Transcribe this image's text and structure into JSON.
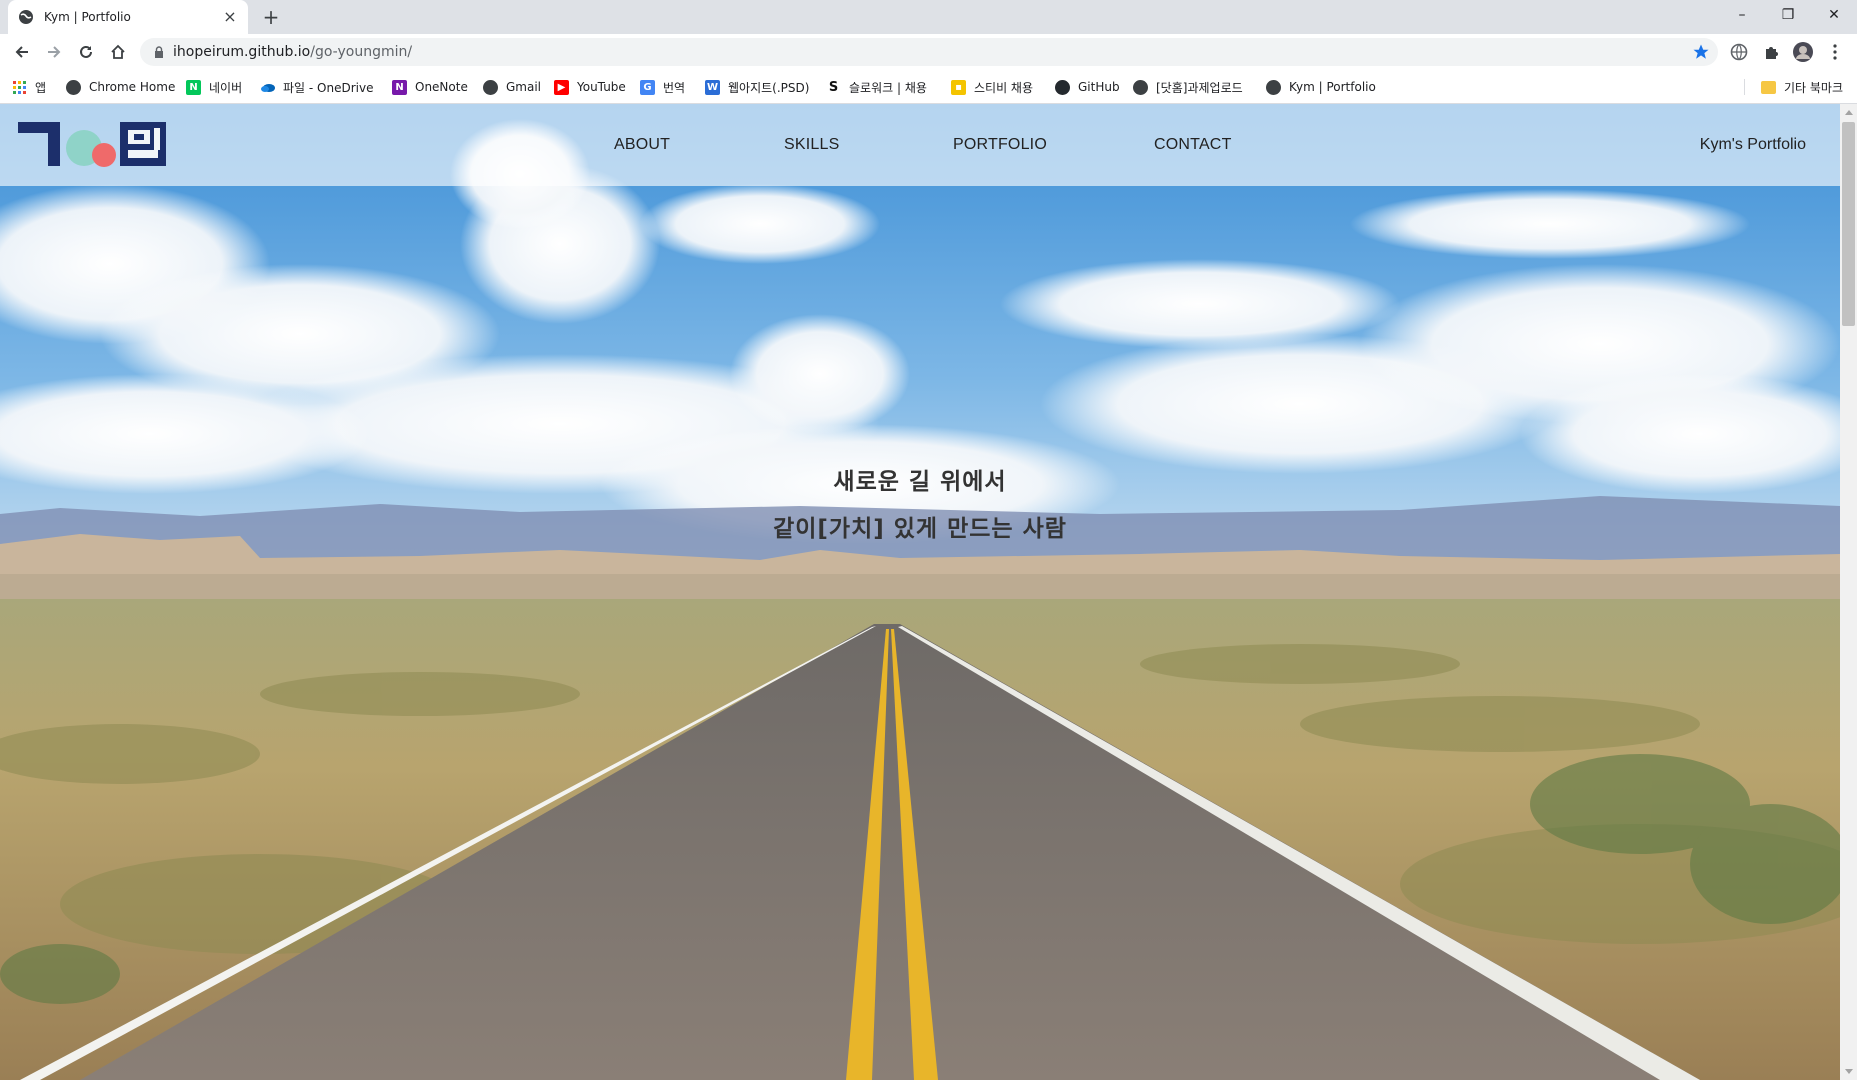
{
  "browser": {
    "tab_title": "Kym | Portfolio",
    "tab_close": "×",
    "new_tab": "+",
    "url_host": "ihopeirum.github.io",
    "url_path": "/go-youngmin/",
    "window": {
      "minimize": "–",
      "restore": "❐",
      "close": "✕"
    }
  },
  "bookmarks": [
    {
      "label": "앱",
      "icon": "apps-grid-icon",
      "color": "#ea4335"
    },
    {
      "label": "Chrome Home",
      "icon": "globe-icon",
      "color": "#3c4043"
    },
    {
      "label": "네이버",
      "icon": "naver-icon",
      "color": "#03c75a"
    },
    {
      "label": "파일 - OneDrive",
      "icon": "onedrive-cloud-icon",
      "color": "#0364b8"
    },
    {
      "label": "OneNote",
      "icon": "onenote-icon",
      "color": "#7719aa"
    },
    {
      "label": "Gmail",
      "icon": "globe-icon",
      "color": "#3c4043"
    },
    {
      "label": "YouTube",
      "icon": "youtube-icon",
      "color": "#ff0000"
    },
    {
      "label": "번역",
      "icon": "translate-icon",
      "color": "#4285f4"
    },
    {
      "label": "웹아지트(.PSD)",
      "icon": "webagit-icon",
      "color": "#2b6dd6"
    },
    {
      "label": "슬로워크 | 채용",
      "icon": "slowalk-icon",
      "color": "#111111"
    },
    {
      "label": "스티비 채용",
      "icon": "stibee-icon",
      "color": "#f4c400"
    },
    {
      "label": "GitHub",
      "icon": "github-icon",
      "color": "#24292e"
    },
    {
      "label": "[닷홈]과제업로드",
      "icon": "globe-icon",
      "color": "#3c4043"
    },
    {
      "label": "Kym | Portfolio",
      "icon": "globe-icon",
      "color": "#3c4043"
    },
    {
      "label": "기타 북마크",
      "icon": "folder-icon",
      "color": "#f6c744"
    }
  ],
  "site": {
    "nav": [
      "ABOUT",
      "SKILLS",
      "PORTFOLIO",
      "CONTACT"
    ],
    "brand": "Kym's Portfolio",
    "logo_colors": {
      "navy": "#1c2f6b",
      "mint": "#8fd3c8",
      "coral": "#ef6a6a"
    },
    "hero_line1": "새로운 길 위에서",
    "hero_line2": "같이[가치] 있게 만드는 사람"
  },
  "colors": {
    "sky": "#5aa3dd",
    "road": "#7d7670",
    "grass": "#b9a776",
    "stripe": "#e8b52a"
  }
}
